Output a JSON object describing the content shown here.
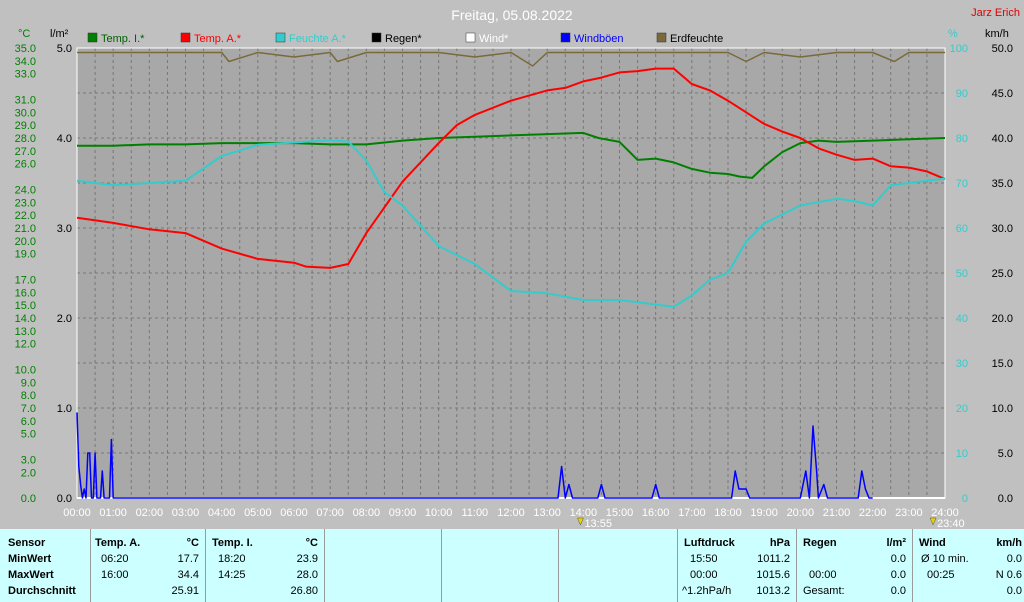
{
  "header": {
    "title": "Freitag, 05.08.2022",
    "author": "Jarz Erich"
  },
  "chart_data": {
    "type": "line",
    "title": "Freitag, 05.08.2022",
    "x_ticks": [
      "00:00",
      "01:00",
      "02:00",
      "03:00",
      "04:00",
      "05:00",
      "06:00",
      "07:00",
      "08:00",
      "09:00",
      "10:00",
      "11:00",
      "12:00",
      "13:00",
      "14:00",
      "15:00",
      "16:00",
      "17:00",
      "18:00",
      "19:00",
      "20:00",
      "21:00",
      "22:00",
      "23:00",
      "24:00"
    ],
    "x_range_hours": [
      0,
      24
    ],
    "axes": {
      "temp": {
        "unit": "°C",
        "ticks": [
          35.0,
          34.0,
          33.0,
          31.0,
          30.0,
          29.0,
          28.0,
          27.0,
          26.0,
          24.0,
          23.0,
          22.0,
          21.0,
          20.0,
          19.0,
          17.0,
          16.0,
          15.0,
          14.0,
          13.0,
          12.0,
          10.0,
          9.0,
          8.0,
          7.0,
          6.0,
          5.0,
          3.0,
          2.0,
          0.0
        ],
        "range": [
          0,
          35
        ]
      },
      "rain": {
        "unit": "l/m²",
        "ticks": [
          5.0,
          4.0,
          3.0,
          2.0,
          1.0,
          0.0
        ],
        "range": [
          0,
          5
        ]
      },
      "humidity": {
        "unit": "%",
        "ticks": [
          100,
          90,
          80,
          70,
          60,
          50,
          40,
          30,
          20,
          10,
          0
        ],
        "range": [
          0,
          100
        ]
      },
      "wind": {
        "unit": "km/h",
        "ticks": [
          50.0,
          45.0,
          40.0,
          35.0,
          30.0,
          25.0,
          20.0,
          15.0,
          10.0,
          5.0,
          0.0
        ],
        "range": [
          0,
          50
        ]
      }
    },
    "grid": true,
    "legend_position": "top",
    "series": [
      {
        "name": "Temp. I.*",
        "color": "#008000",
        "axis": "temp",
        "x": [
          0,
          1,
          2,
          3,
          4,
          5,
          6,
          7,
          8,
          9,
          10,
          11,
          12,
          13,
          14,
          14.42,
          15,
          15.5,
          16,
          16.5,
          17,
          17.5,
          18,
          18.33,
          18.67,
          19,
          19.5,
          20,
          20.5,
          21,
          22,
          23,
          24
        ],
        "y": [
          27.4,
          27.4,
          27.5,
          27.5,
          27.6,
          27.6,
          27.6,
          27.5,
          27.5,
          27.8,
          28.0,
          28.1,
          28.2,
          28.3,
          28.4,
          28.0,
          27.7,
          26.3,
          26.4,
          26.1,
          25.6,
          25.3,
          25.2,
          25.0,
          24.9,
          25.8,
          26.9,
          27.6,
          27.8,
          27.7,
          27.8,
          27.9,
          28.0
        ]
      },
      {
        "name": "Temp. A.*",
        "color": "#ff0000",
        "axis": "temp",
        "x": [
          0,
          1,
          2,
          3,
          4,
          5,
          6,
          6.33,
          7,
          7.5,
          8,
          9,
          10,
          10.5,
          11,
          12,
          13,
          13.5,
          14,
          14.5,
          15,
          15.5,
          16,
          16.5,
          17,
          17.5,
          18,
          18.5,
          19,
          19.5,
          20,
          20.5,
          21,
          21.5,
          22,
          22.5,
          23,
          23.5,
          24
        ],
        "y": [
          21.8,
          21.4,
          20.9,
          20.6,
          19.4,
          18.6,
          18.3,
          18.0,
          17.9,
          18.2,
          20.6,
          24.6,
          27.6,
          29.0,
          29.8,
          30.9,
          31.7,
          31.9,
          32.4,
          32.7,
          33.1,
          33.2,
          33.4,
          33.4,
          32.2,
          31.7,
          30.9,
          30.0,
          29.1,
          28.5,
          28.0,
          27.2,
          26.7,
          26.3,
          26.4,
          25.8,
          25.7,
          25.4,
          24.8
        ]
      },
      {
        "name": "Feuchte A.*",
        "color": "#33cccc",
        "axis": "humidity",
        "x": [
          0,
          1,
          2,
          3,
          4,
          5,
          6,
          6.5,
          7,
          7.5,
          8,
          8.5,
          9,
          10,
          11,
          12,
          13,
          14,
          15,
          16,
          16.5,
          17,
          17.5,
          18,
          18.5,
          19,
          20,
          21,
          21.5,
          22,
          22.5,
          23,
          24
        ],
        "y": [
          70.5,
          69.5,
          70.0,
          70.5,
          76.0,
          78.5,
          79.0,
          79.3,
          79.5,
          79.2,
          75.0,
          68.0,
          65.0,
          56.0,
          52.0,
          46.0,
          45.5,
          44.0,
          44.0,
          43.0,
          42.5,
          45.0,
          48.5,
          50.0,
          57.0,
          61.0,
          65.0,
          66.5,
          66.0,
          65.0,
          69.5,
          70.0,
          71.0
        ]
      },
      {
        "name": "Regen*",
        "color": "#000000",
        "axis": "rain",
        "x": [
          0,
          24
        ],
        "y": [
          0,
          0
        ]
      },
      {
        "name": "Wind*",
        "color": "#ffffff",
        "axis": "wind",
        "x": [
          0,
          24
        ],
        "y": [
          0,
          0
        ]
      },
      {
        "name": "Windböen",
        "color": "#0000ff",
        "axis": "wind",
        "x": [
          0,
          0.05,
          0.1,
          0.15,
          0.2,
          0.25,
          0.3,
          0.35,
          0.4,
          0.45,
          0.5,
          0.55,
          0.6,
          0.65,
          0.7,
          0.75,
          0.8,
          0.85,
          0.9,
          0.95,
          1.0,
          1.05,
          1.1,
          1.15,
          1.2,
          1.25,
          1.3,
          1.35,
          1.4,
          1.45,
          1.5,
          13.3,
          13.4,
          13.5,
          13.6,
          13.7,
          13.8,
          14.4,
          14.5,
          14.6,
          15.9,
          16.0,
          16.1,
          18.1,
          18.2,
          18.3,
          18.5,
          18.6,
          20.0,
          20.15,
          20.25,
          20.35,
          20.45,
          20.5,
          20.65,
          20.75,
          20.85,
          21.6,
          21.7,
          21.8,
          21.9,
          22.0
        ],
        "y": [
          9.5,
          3.5,
          1.5,
          0,
          1,
          0,
          5,
          5,
          0,
          0,
          5,
          0,
          0,
          0,
          3,
          0,
          0,
          0,
          0,
          6.5,
          0,
          0,
          0,
          0,
          0,
          0,
          0,
          0,
          0,
          0,
          0,
          0,
          3.5,
          0,
          1.5,
          0,
          0,
          0,
          1.5,
          0,
          0,
          1.5,
          0,
          0,
          3,
          1,
          1,
          0,
          0,
          3,
          0,
          8,
          3,
          0,
          1.5,
          0,
          0,
          0,
          3,
          1,
          0,
          0
        ]
      },
      {
        "name": "Erdfeuchte",
        "color": "#7a6a3a",
        "axis": "humidity",
        "x": [
          0,
          1,
          2,
          3,
          4,
          4.2,
          5,
          6,
          7,
          7.2,
          8,
          9,
          10,
          11,
          12,
          12.6,
          13,
          14,
          15,
          16,
          17,
          18,
          18.5,
          19,
          20,
          21,
          22,
          22.6,
          23,
          24
        ],
        "y": [
          99,
          99,
          99,
          99,
          99,
          97,
          99,
          98,
          99,
          97,
          99,
          99,
          99,
          98,
          99,
          96,
          99,
          99,
          99,
          99,
          99,
          99,
          97,
          99,
          98,
          99,
          99,
          97,
          99,
          99
        ]
      }
    ],
    "annotations": [
      {
        "label": "13:55",
        "x": 13.92
      },
      {
        "label": "23:40",
        "x": 23.67
      }
    ]
  },
  "panel": {
    "sensor": {
      "title": "Sensor",
      "rows": [
        "MinWert",
        "MaxWert",
        "Durchschnitt"
      ]
    },
    "temp_a": {
      "title": "Temp. A.",
      "unit": "°C",
      "min_time": "06:20",
      "min_val": "17.7",
      "max_time": "16:00",
      "max_val": "34.4",
      "avg": "25.91"
    },
    "temp_i": {
      "title": "Temp. I.",
      "unit": "°C",
      "min_time": "18:20",
      "min_val": "23.9",
      "max_time": "14:25",
      "max_val": "28.0",
      "avg": "26.80"
    },
    "luftdruck": {
      "title": "Luftdruck",
      "unit": "hPa",
      "r1_time": "15:50",
      "r1_val": "1011.2",
      "r2_time": "00:00",
      "r2_val": "1015.6",
      "r3_time": "^1.2hPa/h",
      "r3_val": "1013.2"
    },
    "regen": {
      "title": "Regen",
      "unit": "l/m²",
      "r2_time": "00:00",
      "r2_val": "0.0",
      "r3_label": "Gesamt:",
      "r3_val": "0.0",
      "r1_val": "0.0"
    },
    "wind": {
      "title": "Wind",
      "unit": "km/h",
      "r1_label": "Ø 10 min.",
      "r1_val": "0.0",
      "r2_time": "00:25",
      "r2_val": "N 0.6",
      "r3_val": "0.0"
    }
  }
}
